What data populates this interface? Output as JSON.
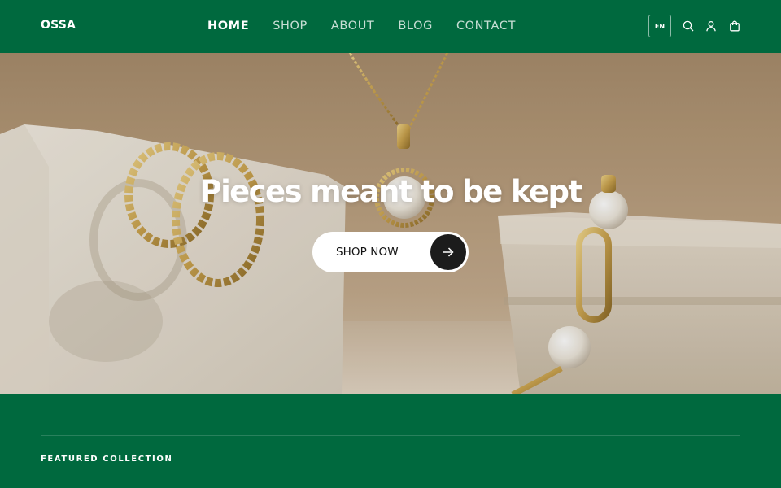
{
  "header": {
    "logo": "OSSA",
    "nav": [
      {
        "label": "HOME",
        "active": true
      },
      {
        "label": "SHOP",
        "active": false
      },
      {
        "label": "ABOUT",
        "active": false
      },
      {
        "label": "BLOG",
        "active": false
      },
      {
        "label": "CONTACT",
        "active": false
      }
    ],
    "language": "EN",
    "icons": [
      "search-icon",
      "account-icon",
      "cart-icon"
    ]
  },
  "hero": {
    "title": "Pieces meant to be kept",
    "cta_label": "SHOP NOW",
    "cta_icon": "arrow-right-icon"
  },
  "featured": {
    "title": "FEATURED COLLECTION"
  },
  "colors": {
    "brand_green": "#00693e",
    "button_dark": "#1c1c1c",
    "text_white": "#ffffff"
  }
}
